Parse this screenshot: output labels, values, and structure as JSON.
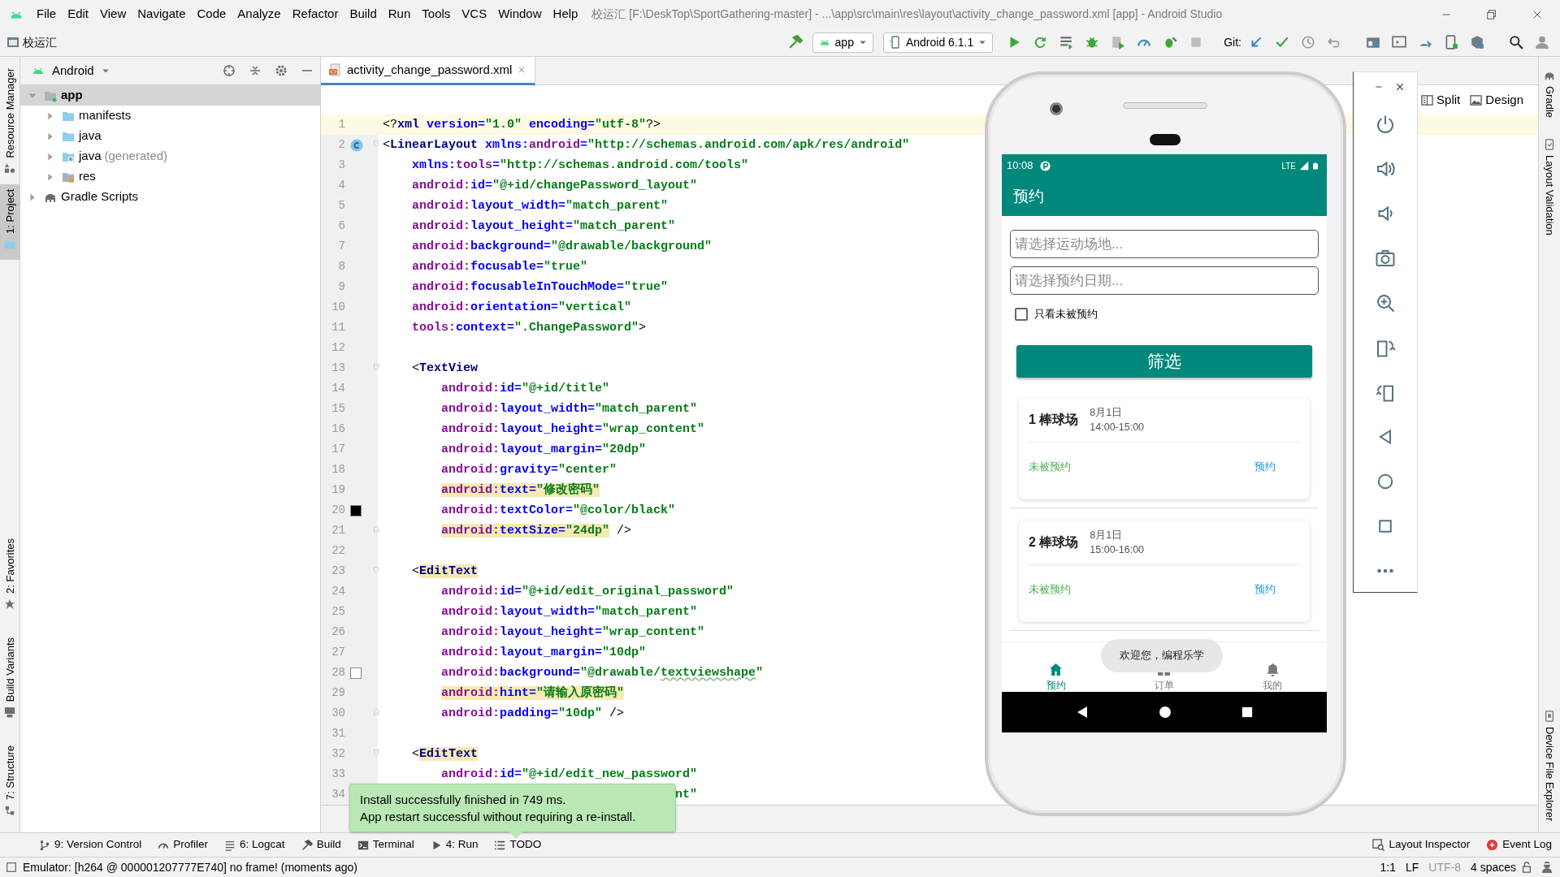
{
  "window": {
    "title": "校运汇 [F:\\DeskTop\\SportGathering-master] - ...\\app\\src\\main\\res\\layout\\activity_change_password.xml [app] - Android Studio"
  },
  "menu": [
    "File",
    "Edit",
    "View",
    "Navigate",
    "Code",
    "Analyze",
    "Refactor",
    "Build",
    "Run",
    "Tools",
    "VCS",
    "Window",
    "Help"
  ],
  "toolbar": {
    "project": "校运汇",
    "run_config": "app",
    "device": "Android 6.1.1",
    "vcs_label": "Git:"
  },
  "left_stripe": {
    "top": [
      {
        "label": "Resource Manager",
        "selected": false
      },
      {
        "label": "1: Project",
        "selected": true
      }
    ],
    "bottom": [
      {
        "label": "2: Favorites",
        "selected": false
      },
      {
        "label": "Build Variants",
        "selected": false
      },
      {
        "label": "7: Structure",
        "selected": false
      }
    ]
  },
  "right_stripe": {
    "top": [
      "Gradle",
      "Layout Validation"
    ],
    "bottom": [
      "Device File Explorer"
    ]
  },
  "project_panel": {
    "view": "Android",
    "tree": [
      {
        "name": "app",
        "kind": "module",
        "expanded": true,
        "selected": true,
        "children": [
          {
            "name": "manifests",
            "kind": "folder",
            "expanded": false,
            "selected": false
          },
          {
            "name": "java",
            "kind": "folder",
            "expanded": false,
            "selected": false
          },
          {
            "name": "java",
            "suffix": "(generated)",
            "kind": "generated",
            "expanded": false,
            "selected": false
          },
          {
            "name": "res",
            "kind": "res",
            "expanded": false,
            "selected": false
          }
        ]
      },
      {
        "name": "Gradle Scripts",
        "kind": "gradle",
        "expanded": false,
        "selected": false
      }
    ]
  },
  "editor": {
    "tab": "activity_change_password.xml",
    "view_modes": [
      "Split",
      "Design"
    ],
    "lines": [
      {
        "number": "1",
        "current": true,
        "parts": [
          {
            "kind": "punct",
            "text": "<?"
          },
          {
            "kind": "tag",
            "text": "xml"
          },
          {
            "kind": "attr",
            "text": " version="
          },
          {
            "kind": "value",
            "text": "\"1.0\""
          },
          {
            "kind": "attr",
            "text": " encoding="
          },
          {
            "kind": "value",
            "text": "\"utf-8\""
          },
          {
            "kind": "punct",
            "text": "?>"
          }
        ]
      },
      {
        "number": "2",
        "current": false,
        "fold": {
          "kind": "start"
        },
        "gutter": {
          "kind": "class"
        },
        "parts": [
          {
            "kind": "punct",
            "text": "<"
          },
          {
            "kind": "tag",
            "text": "LinearLayout"
          },
          {
            "kind": "attr",
            "text": " xmlns:"
          },
          {
            "kind": "ns",
            "text": "android"
          },
          {
            "kind": "attr",
            "text": "="
          },
          {
            "kind": "value",
            "text": "\"http://schemas.android.com/apk/res/android\""
          }
        ]
      },
      {
        "number": "3",
        "current": false,
        "parts": [
          {
            "kind": "attr",
            "text": "    xmlns:"
          },
          {
            "kind": "ns",
            "text": "tools"
          },
          {
            "kind": "attr",
            "text": "="
          },
          {
            "kind": "value",
            "text": "\"http://schemas.android.com/tools\""
          }
        ]
      },
      {
        "number": "4",
        "current": false,
        "parts": [
          {
            "kind": "ns",
            "text": "    android:"
          },
          {
            "kind": "attr",
            "text": "id="
          },
          {
            "kind": "value",
            "text": "\"@+id/changePassword_layout\""
          }
        ]
      },
      {
        "number": "5",
        "current": false,
        "parts": [
          {
            "kind": "ns",
            "text": "    android:"
          },
          {
            "kind": "attr",
            "text": "layout_width="
          },
          {
            "kind": "value",
            "text": "\"match_parent\""
          }
        ]
      },
      {
        "number": "6",
        "current": false,
        "parts": [
          {
            "kind": "ns",
            "text": "    android:"
          },
          {
            "kind": "attr",
            "text": "layout_height="
          },
          {
            "kind": "value",
            "text": "\"match_parent\""
          }
        ]
      },
      {
        "number": "7",
        "current": false,
        "parts": [
          {
            "kind": "ns",
            "text": "    android:"
          },
          {
            "kind": "attr",
            "text": "background="
          },
          {
            "kind": "value",
            "text": "\"@drawable/background\""
          }
        ]
      },
      {
        "number": "8",
        "current": false,
        "parts": [
          {
            "kind": "ns",
            "text": "    android:"
          },
          {
            "kind": "attr",
            "text": "focusable="
          },
          {
            "kind": "value",
            "text": "\"true\""
          }
        ]
      },
      {
        "number": "9",
        "current": false,
        "parts": [
          {
            "kind": "ns",
            "text": "    android:"
          },
          {
            "kind": "attr",
            "text": "focusableInTouchMode="
          },
          {
            "kind": "value",
            "text": "\"true\""
          }
        ]
      },
      {
        "number": "10",
        "current": false,
        "parts": [
          {
            "kind": "ns",
            "text": "    android:"
          },
          {
            "kind": "attr",
            "text": "orientation="
          },
          {
            "kind": "value",
            "text": "\"vertical\""
          }
        ]
      },
      {
        "number": "11",
        "current": false,
        "parts": [
          {
            "kind": "ns",
            "text": "    tools:"
          },
          {
            "kind": "attr",
            "text": "context="
          },
          {
            "kind": "value",
            "text": "\".ChangePassword\""
          },
          {
            "kind": "punct",
            "text": ">"
          }
        ]
      },
      {
        "number": "12",
        "current": false
      },
      {
        "number": "13",
        "current": false,
        "fold": {
          "kind": "start"
        },
        "parts": [
          {
            "kind": "punct",
            "text": "    <"
          },
          {
            "kind": "tag",
            "text": "TextView"
          }
        ]
      },
      {
        "number": "14",
        "current": false,
        "parts": [
          {
            "kind": "ns",
            "text": "        android:"
          },
          {
            "kind": "attr",
            "text": "id="
          },
          {
            "kind": "value",
            "text": "\"@+id/title\""
          }
        ]
      },
      {
        "number": "15",
        "current": false,
        "parts": [
          {
            "kind": "ns",
            "text": "        android:"
          },
          {
            "kind": "attr",
            "text": "layout_width="
          },
          {
            "kind": "value",
            "text": "\"match_parent\""
          }
        ]
      },
      {
        "number": "16",
        "current": false,
        "parts": [
          {
            "kind": "ns",
            "text": "        android:"
          },
          {
            "kind": "attr",
            "text": "layout_height="
          },
          {
            "kind": "value",
            "text": "\"wrap_content\""
          }
        ]
      },
      {
        "number": "17",
        "current": false,
        "parts": [
          {
            "kind": "ns",
            "text": "        android:"
          },
          {
            "kind": "attr",
            "text": "layout_margin="
          },
          {
            "kind": "value",
            "text": "\"20dp\""
          }
        ]
      },
      {
        "number": "18",
        "current": false,
        "parts": [
          {
            "kind": "ns",
            "text": "        android:"
          },
          {
            "kind": "attr",
            "text": "gravity="
          },
          {
            "kind": "value",
            "text": "\"center\""
          }
        ]
      },
      {
        "number": "19",
        "current": false,
        "parts": [
          {
            "kind": "highlight",
            "parts": [
              {
                "kind": "ns",
                "text": "android:"
              },
              {
                "kind": "attr",
                "text": "text="
              },
              {
                "kind": "value",
                "text": "\"修改密码\""
              }
            ]
          }
        ]
      },
      {
        "number": "20",
        "current": false,
        "gutter": {
          "kind": "swatch",
          "color": "#000000"
        },
        "parts": [
          {
            "kind": "ns",
            "text": "        android:"
          },
          {
            "kind": "attr",
            "text": "textColor="
          },
          {
            "kind": "value",
            "text": "\"@color/black\""
          }
        ]
      },
      {
        "number": "21",
        "current": false,
        "fold": {
          "kind": "end"
        },
        "parts": [
          {
            "kind": "highlight",
            "parts": [
              {
                "kind": "ns",
                "text": "android:"
              },
              {
                "kind": "attr",
                "text": "textSize="
              },
              {
                "kind": "value",
                "text": "\"24dp\""
              }
            ]
          },
          {
            "kind": "punct",
            "text": " />"
          }
        ]
      },
      {
        "number": "22",
        "current": false
      },
      {
        "number": "23",
        "current": false,
        "fold": {
          "kind": "start"
        },
        "parts": [
          {
            "kind": "punct",
            "text": "    <"
          },
          {
            "kind": "highlight",
            "parts": [
              {
                "kind": "tag",
                "text": "EditText"
              }
            ]
          }
        ]
      },
      {
        "number": "24",
        "current": false,
        "parts": [
          {
            "kind": "ns",
            "text": "        android:"
          },
          {
            "kind": "attr",
            "text": "id="
          },
          {
            "kind": "value",
            "text": "\"@+id/edit_original_password\""
          }
        ]
      },
      {
        "number": "25",
        "current": false,
        "parts": [
          {
            "kind": "ns",
            "text": "        android:"
          },
          {
            "kind": "attr",
            "text": "layout_width="
          },
          {
            "kind": "value",
            "text": "\"match_parent\""
          }
        ]
      },
      {
        "number": "26",
        "current": false,
        "parts": [
          {
            "kind": "ns",
            "text": "        android:"
          },
          {
            "kind": "attr",
            "text": "layout_height="
          },
          {
            "kind": "value",
            "text": "\"wrap_content\""
          }
        ]
      },
      {
        "number": "27",
        "current": false,
        "parts": [
          {
            "kind": "ns",
            "text": "        android:"
          },
          {
            "kind": "attr",
            "text": "layout_margin="
          },
          {
            "kind": "value",
            "text": "\"10dp\""
          }
        ]
      },
      {
        "number": "28",
        "current": false,
        "gutter": {
          "kind": "swatch",
          "color": "#ffffff"
        },
        "parts": [
          {
            "kind": "ns",
            "text": "        android:"
          },
          {
            "kind": "attr",
            "text": "background="
          },
          {
            "kind": "value",
            "text": "\"@drawable/"
          },
          {
            "kind": "typo",
            "text": "textviewshape"
          },
          {
            "kind": "value",
            "text": "\""
          }
        ]
      },
      {
        "number": "29",
        "current": false,
        "parts": [
          {
            "kind": "highlight",
            "parts": [
              {
                "kind": "ns",
                "text": "android:"
              },
              {
                "kind": "attr",
                "text": "hint="
              },
              {
                "kind": "value",
                "text": "\"请输入原密码\""
              }
            ]
          }
        ]
      },
      {
        "number": "30",
        "current": false,
        "fold": {
          "kind": "end"
        },
        "parts": [
          {
            "kind": "ns",
            "text": "        android:"
          },
          {
            "kind": "attr",
            "text": "padding="
          },
          {
            "kind": "value",
            "text": "\"10dp\""
          },
          {
            "kind": "punct",
            "text": " />"
          }
        ]
      },
      {
        "number": "31",
        "current": false
      },
      {
        "number": "32",
        "current": false,
        "fold": {
          "kind": "start"
        },
        "parts": [
          {
            "kind": "punct",
            "text": "    <"
          },
          {
            "kind": "highlight",
            "parts": [
              {
                "kind": "tag",
                "text": "EditText"
              }
            ]
          }
        ]
      },
      {
        "number": "33",
        "current": false,
        "parts": [
          {
            "kind": "ns",
            "text": "        android:"
          },
          {
            "kind": "attr",
            "text": "id="
          },
          {
            "kind": "value",
            "text": "\"@+id/edit_new_password\""
          }
        ]
      },
      {
        "number": "34",
        "current": false,
        "parts": [
          {
            "kind": "value",
            "text": "                                        nt\""
          }
        ]
      }
    ]
  },
  "emulator": {
    "status_time": "10:08",
    "network": "LTE",
    "app_title": "预约",
    "fields": [
      {
        "placeholder": "请选择运动场地..."
      },
      {
        "placeholder": "请选择预约日期..."
      }
    ],
    "filter_checkbox": {
      "label": "只看未被预约",
      "checked": false
    },
    "filter_button": "筛选",
    "bookings": [
      {
        "index": "1",
        "venue": "棒球场",
        "date": "8月1日",
        "time": "14:00-15:00",
        "status": "未被预约",
        "action": "预约"
      },
      {
        "index": "2",
        "venue": "棒球场",
        "date": "8月1日",
        "time": "15:00-16:00",
        "status": "未被预约",
        "action": "预约"
      }
    ],
    "toast": "欢迎您，编程乐学",
    "bottom_nav": [
      {
        "label": "预约",
        "selected": true
      },
      {
        "label": "订单",
        "selected": false
      },
      {
        "label": "我的",
        "selected": false
      }
    ]
  },
  "notification": [
    "Install successfully finished in 749 ms.",
    "App restart successful without requiring a re-install."
  ],
  "tool_windows": {
    "left": [
      "9: Version Control",
      "Profiler",
      "6: Logcat",
      "Build",
      "Terminal",
      "4: Run",
      "TODO"
    ],
    "right": [
      "Layout Inspector",
      "Event Log"
    ]
  },
  "status_bar": {
    "message": "Emulator: [h264 @ 000001207777E740] no frame! (moments ago)",
    "items": [
      {
        "text": "1:1",
        "disabled": false
      },
      {
        "text": "LF",
        "disabled": false
      },
      {
        "text": "UTF-8",
        "disabled": true
      },
      {
        "text": "4 spaces",
        "disabled": false
      }
    ]
  }
}
